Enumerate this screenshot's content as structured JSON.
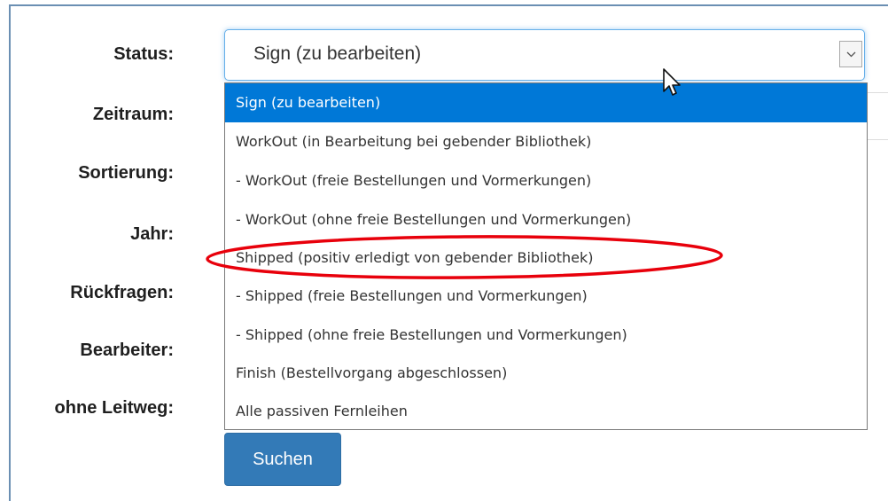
{
  "form": {
    "labels": {
      "status": "Status:",
      "zeitraum": "Zeitraum:",
      "sortierung": "Sortierung:",
      "jahr": "Jahr:",
      "rueckfragen": "Rückfragen:",
      "bearbeiter": "Bearbeiter:",
      "ohne_leitweg": "ohne Leitweg:"
    },
    "status_select": {
      "value": "Sign (zu bearbeiten)",
      "options": [
        "Sign (zu bearbeiten)",
        "WorkOut (in Bearbeitung bei gebender Bibliothek)",
        "- WorkOut (freie Bestellungen und Vormerkungen)",
        "- WorkOut (ohne freie Bestellungen und Vormerkungen)",
        "Shipped (positiv erledigt von gebender Bibliothek)",
        "- Shipped (freie Bestellungen und Vormerkungen)",
        "- Shipped (ohne freie Bestellungen und Vormerkungen)",
        "Finish (Bestellvorgang abgeschlossen)",
        "Alle passiven Fernleihen"
      ],
      "highlighted_index": 0,
      "annotated_index": 4
    },
    "search_button": "Suchen"
  },
  "colors": {
    "selected_option": "#0078d7",
    "button": "#337ab7",
    "annotation": "#e8000b",
    "frame": "#6b8fb3"
  },
  "icons": {
    "select_arrow": "chevron-down-icon",
    "cursor": "mouse-pointer-icon"
  }
}
